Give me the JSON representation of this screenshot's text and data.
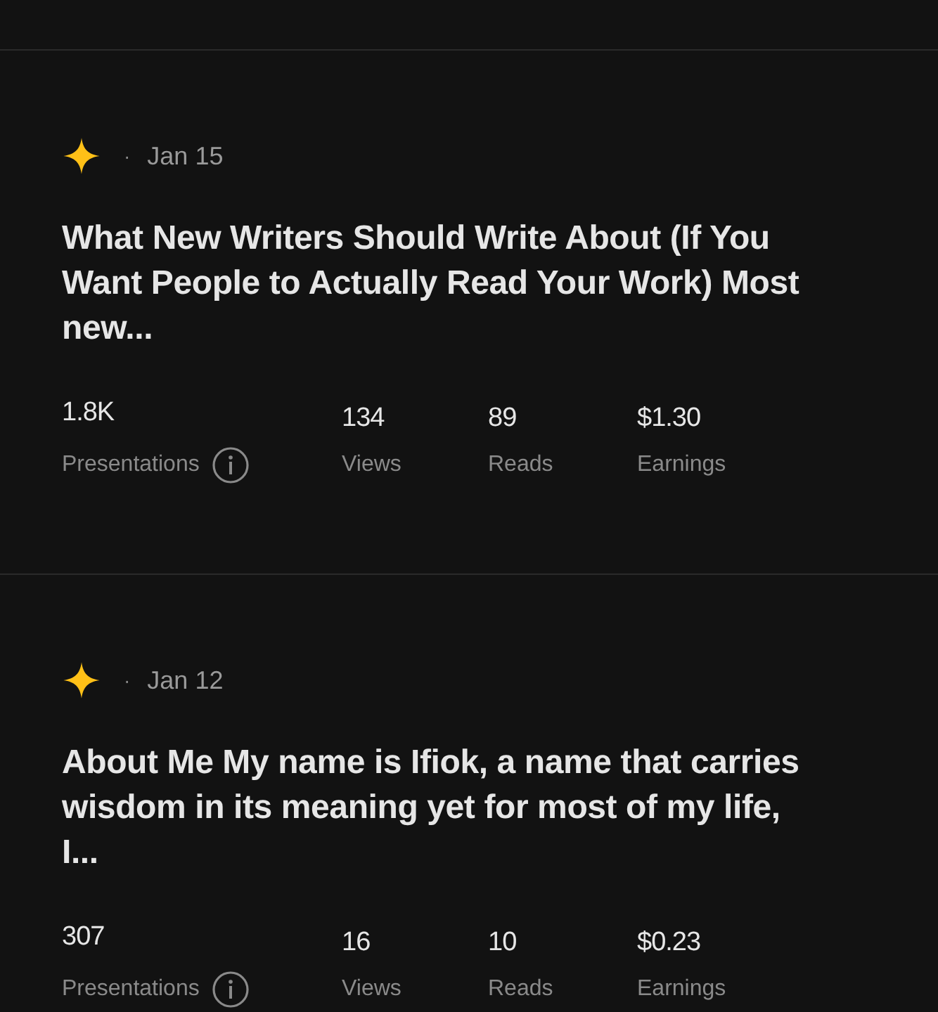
{
  "stories": [
    {
      "date": "Jan 15",
      "separator": "·",
      "title": "What New Writers Should Write About (If You Want People to Actually Read Your Work) Most new...",
      "stats": [
        {
          "value": "1.8K",
          "label": "Presentations",
          "info": true
        },
        {
          "value": "134",
          "label": "Views",
          "info": false
        },
        {
          "value": "89",
          "label": "Reads",
          "info": false
        },
        {
          "value": "$1.30",
          "label": "Earnings",
          "info": false
        }
      ]
    },
    {
      "date": "Jan 12",
      "separator": "·",
      "title": "About Me My name is Ifiok, a name that carries wisdom in its meaning yet for most of my life, I...",
      "stats": [
        {
          "value": "307",
          "label": "Presentations",
          "info": true
        },
        {
          "value": "16",
          "label": "Views",
          "info": false
        },
        {
          "value": "10",
          "label": "Reads",
          "info": false
        },
        {
          "value": "$0.23",
          "label": "Earnings",
          "info": false
        }
      ]
    }
  ]
}
